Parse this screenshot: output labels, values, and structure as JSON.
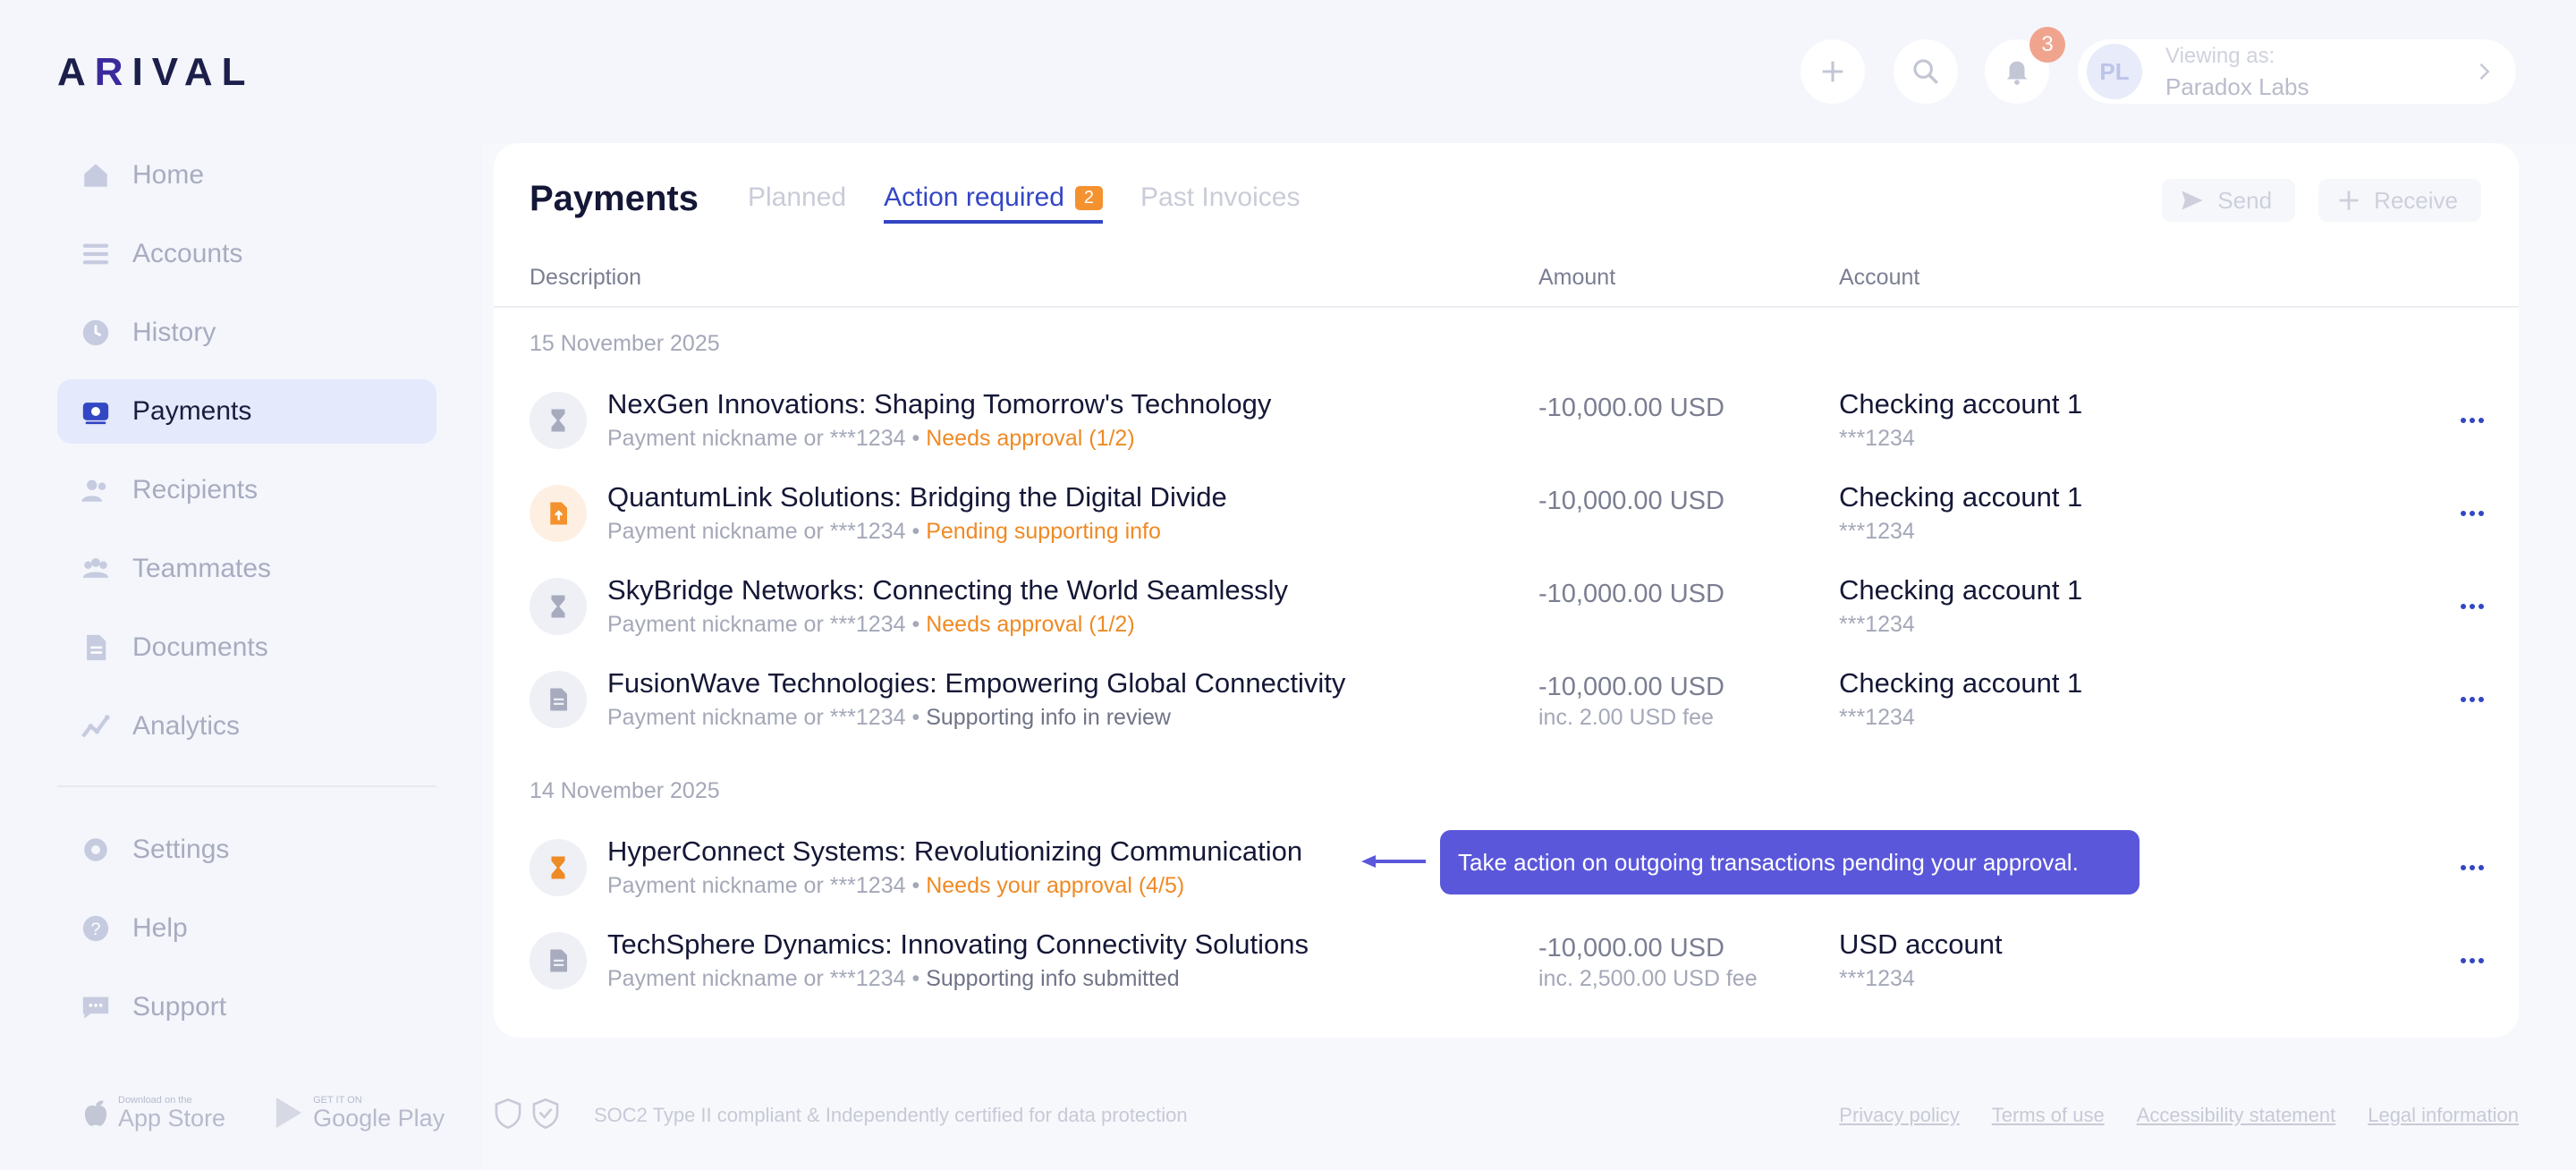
{
  "app": {
    "logo": "ARIVAL",
    "logo_a": "A",
    "logo_r": "R",
    "logo_rest": "IVAL"
  },
  "sidebar": {
    "items": [
      {
        "label": "Home",
        "icon": "home-icon"
      },
      {
        "label": "Accounts",
        "icon": "accounts-icon"
      },
      {
        "label": "History",
        "icon": "history-icon"
      },
      {
        "label": "Payments",
        "icon": "payments-icon",
        "active": true
      },
      {
        "label": "Recipients",
        "icon": "recipients-icon"
      },
      {
        "label": "Teammates",
        "icon": "teammates-icon"
      },
      {
        "label": "Documents",
        "icon": "documents-icon"
      },
      {
        "label": "Analytics",
        "icon": "analytics-icon"
      }
    ],
    "secondary": [
      {
        "label": "Settings",
        "icon": "gear-icon"
      },
      {
        "label": "Help",
        "icon": "help-icon"
      },
      {
        "label": "Support",
        "icon": "chat-icon"
      }
    ],
    "stores": {
      "apple_small": "Download on the",
      "apple_big": "App Store",
      "google_small": "GET IT ON",
      "google_big": "Google Play"
    }
  },
  "topbar": {
    "notifications_count": "3",
    "viewing_label": "Viewing as:",
    "viewing_name": "Paradox Labs",
    "avatar_initials": "PL"
  },
  "payments": {
    "title": "Payments",
    "tabs": [
      {
        "label": "Planned"
      },
      {
        "label": "Action required",
        "badge": "2",
        "active": true
      },
      {
        "label": "Past Invoices"
      }
    ],
    "send_label": "Send",
    "receive_label": "Receive",
    "columns": {
      "description": "Description",
      "amount": "Amount",
      "account": "Account"
    },
    "groups": [
      {
        "date": "15 November 2025",
        "rows": [
          {
            "title": "NexGen Innovations: Shaping Tomorrow's Technology",
            "nickname": "Payment nickname or ***1234",
            "sep": "•",
            "status": "Needs approval (1/2)",
            "amount": "-10,000.00 USD",
            "fee": "",
            "account": "Checking account 1",
            "account_num": "***1234"
          },
          {
            "title": "QuantumLink Solutions: Bridging the Digital Divide",
            "nickname": "Payment nickname or ***1234",
            "sep": "•",
            "status": "Pending supporting info",
            "amount": "-10,000.00 USD",
            "fee": "",
            "account": "Checking account 1",
            "account_num": "***1234"
          },
          {
            "title": "SkyBridge Networks: Connecting the World Seamlessly",
            "nickname": "Payment nickname or ***1234",
            "sep": "•",
            "status": "Needs approval (1/2)",
            "amount": "-10,000.00 USD",
            "fee": "",
            "account": "Checking account 1",
            "account_num": "***1234"
          },
          {
            "title": "FusionWave Technologies: Empowering Global Connectivity",
            "nickname": "Payment nickname or ***1234",
            "sep": "•",
            "status": "Supporting info in review",
            "amount": "-10,000.00 USD",
            "fee": "inc. 2.00 USD fee",
            "account": "Checking account 1",
            "account_num": "***1234"
          }
        ]
      },
      {
        "date": "14 November 2025",
        "rows": [
          {
            "title": "HyperConnect Systems: Revolutionizing Communication",
            "nickname": "Payment nickname or ***1234",
            "sep": "•",
            "status": "Needs your approval (4/5)",
            "amount": "",
            "fee": "",
            "account": "",
            "account_num": ""
          },
          {
            "title": "TechSphere Dynamics: Innovating Connectivity Solutions",
            "nickname": "Payment nickname or ***1234",
            "sep": "•",
            "status": "Supporting info submitted",
            "amount": "-10,000.00 USD",
            "fee": "inc. 2,500.00 USD fee",
            "account": "USD account",
            "account_num": "***1234"
          }
        ]
      }
    ],
    "tooltip": "Take action on outgoing transactions pending your approval."
  },
  "footer": {
    "compliance": "SOC2 Type II compliant & Independently certified for data protection",
    "links": [
      "Privacy policy",
      "Terms of use",
      "Accessibility statement",
      "Legal information"
    ]
  },
  "colors": {
    "accent": "#3346c4",
    "warning": "#ef8a24",
    "tooltip": "#5a57da"
  }
}
